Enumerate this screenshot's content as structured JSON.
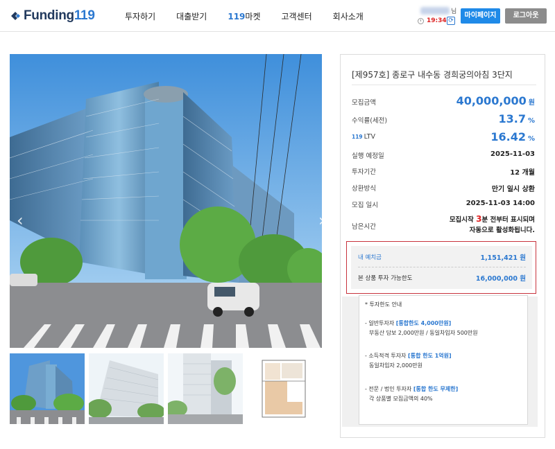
{
  "header": {
    "logo_text": "Funding",
    "logo_num": "119",
    "nav": [
      "투자하기",
      "대출받기",
      "마켓",
      "고객센터",
      "회사소개"
    ],
    "nav_market_prefix": "119",
    "user_suffix": "님",
    "timer": "19:34",
    "mypage_label": "마이페이지",
    "logout_label": "로그아웃",
    "brand_color": "#223a5e",
    "accent_color": "#2b78d0"
  },
  "product": {
    "title": "[제957호] 종로구 내수동 경희궁의아침 3단지",
    "rows": {
      "amount": {
        "label": "모집금액",
        "value": "40,000,000",
        "unit": "원"
      },
      "yield": {
        "label": "수익률(세전)",
        "value": "13.7",
        "unit": "%"
      },
      "ltv": {
        "prefix": "119",
        "label": "LTV",
        "value": "16.42",
        "unit": "%"
      },
      "exec_date": {
        "label": "실행 예정일",
        "value": "2025-11-03"
      },
      "period": {
        "label": "투자기간",
        "value": "12 개월"
      },
      "repay": {
        "label": "상환방식",
        "value": "만기 일시 상환"
      },
      "open": {
        "label": "모집 일시",
        "value": "2025-11-03 14:00"
      },
      "remaining": {
        "label": "남은시간",
        "line1_a": "모집시작 ",
        "line1_num": "3",
        "line1_b": "분 전부터 표시되며",
        "line2": "자동으로 활성화됩니다."
      }
    },
    "deposit": {
      "label": "내 예치금",
      "value": "1,151,421 원",
      "limit_label": "본 상품 투자 가능한도",
      "limit_value": "16,000,000 원"
    },
    "guide": {
      "title": "* 투자한도 안내",
      "g1_a": "- 일반투자자 ",
      "g1_hl": "[통합한도 4,000만원]",
      "g1_sub": "부동산 담보 2,000만원 / 동일차입자 500만원",
      "g2_a": "- 소득적격 투자자 ",
      "g2_hl": "[통합 한도 1억원]",
      "g2_sub": "동일차입자 2,000만원",
      "g3_a": "- 전문 / 법인 투자자 ",
      "g3_hl": "[통합 한도 무제한]",
      "g3_sub": "각 상품별 모집금액의 40%"
    }
  },
  "gallery": {
    "thumbnails": [
      "building-front",
      "building-side",
      "building-tall",
      "floor-plan"
    ]
  }
}
